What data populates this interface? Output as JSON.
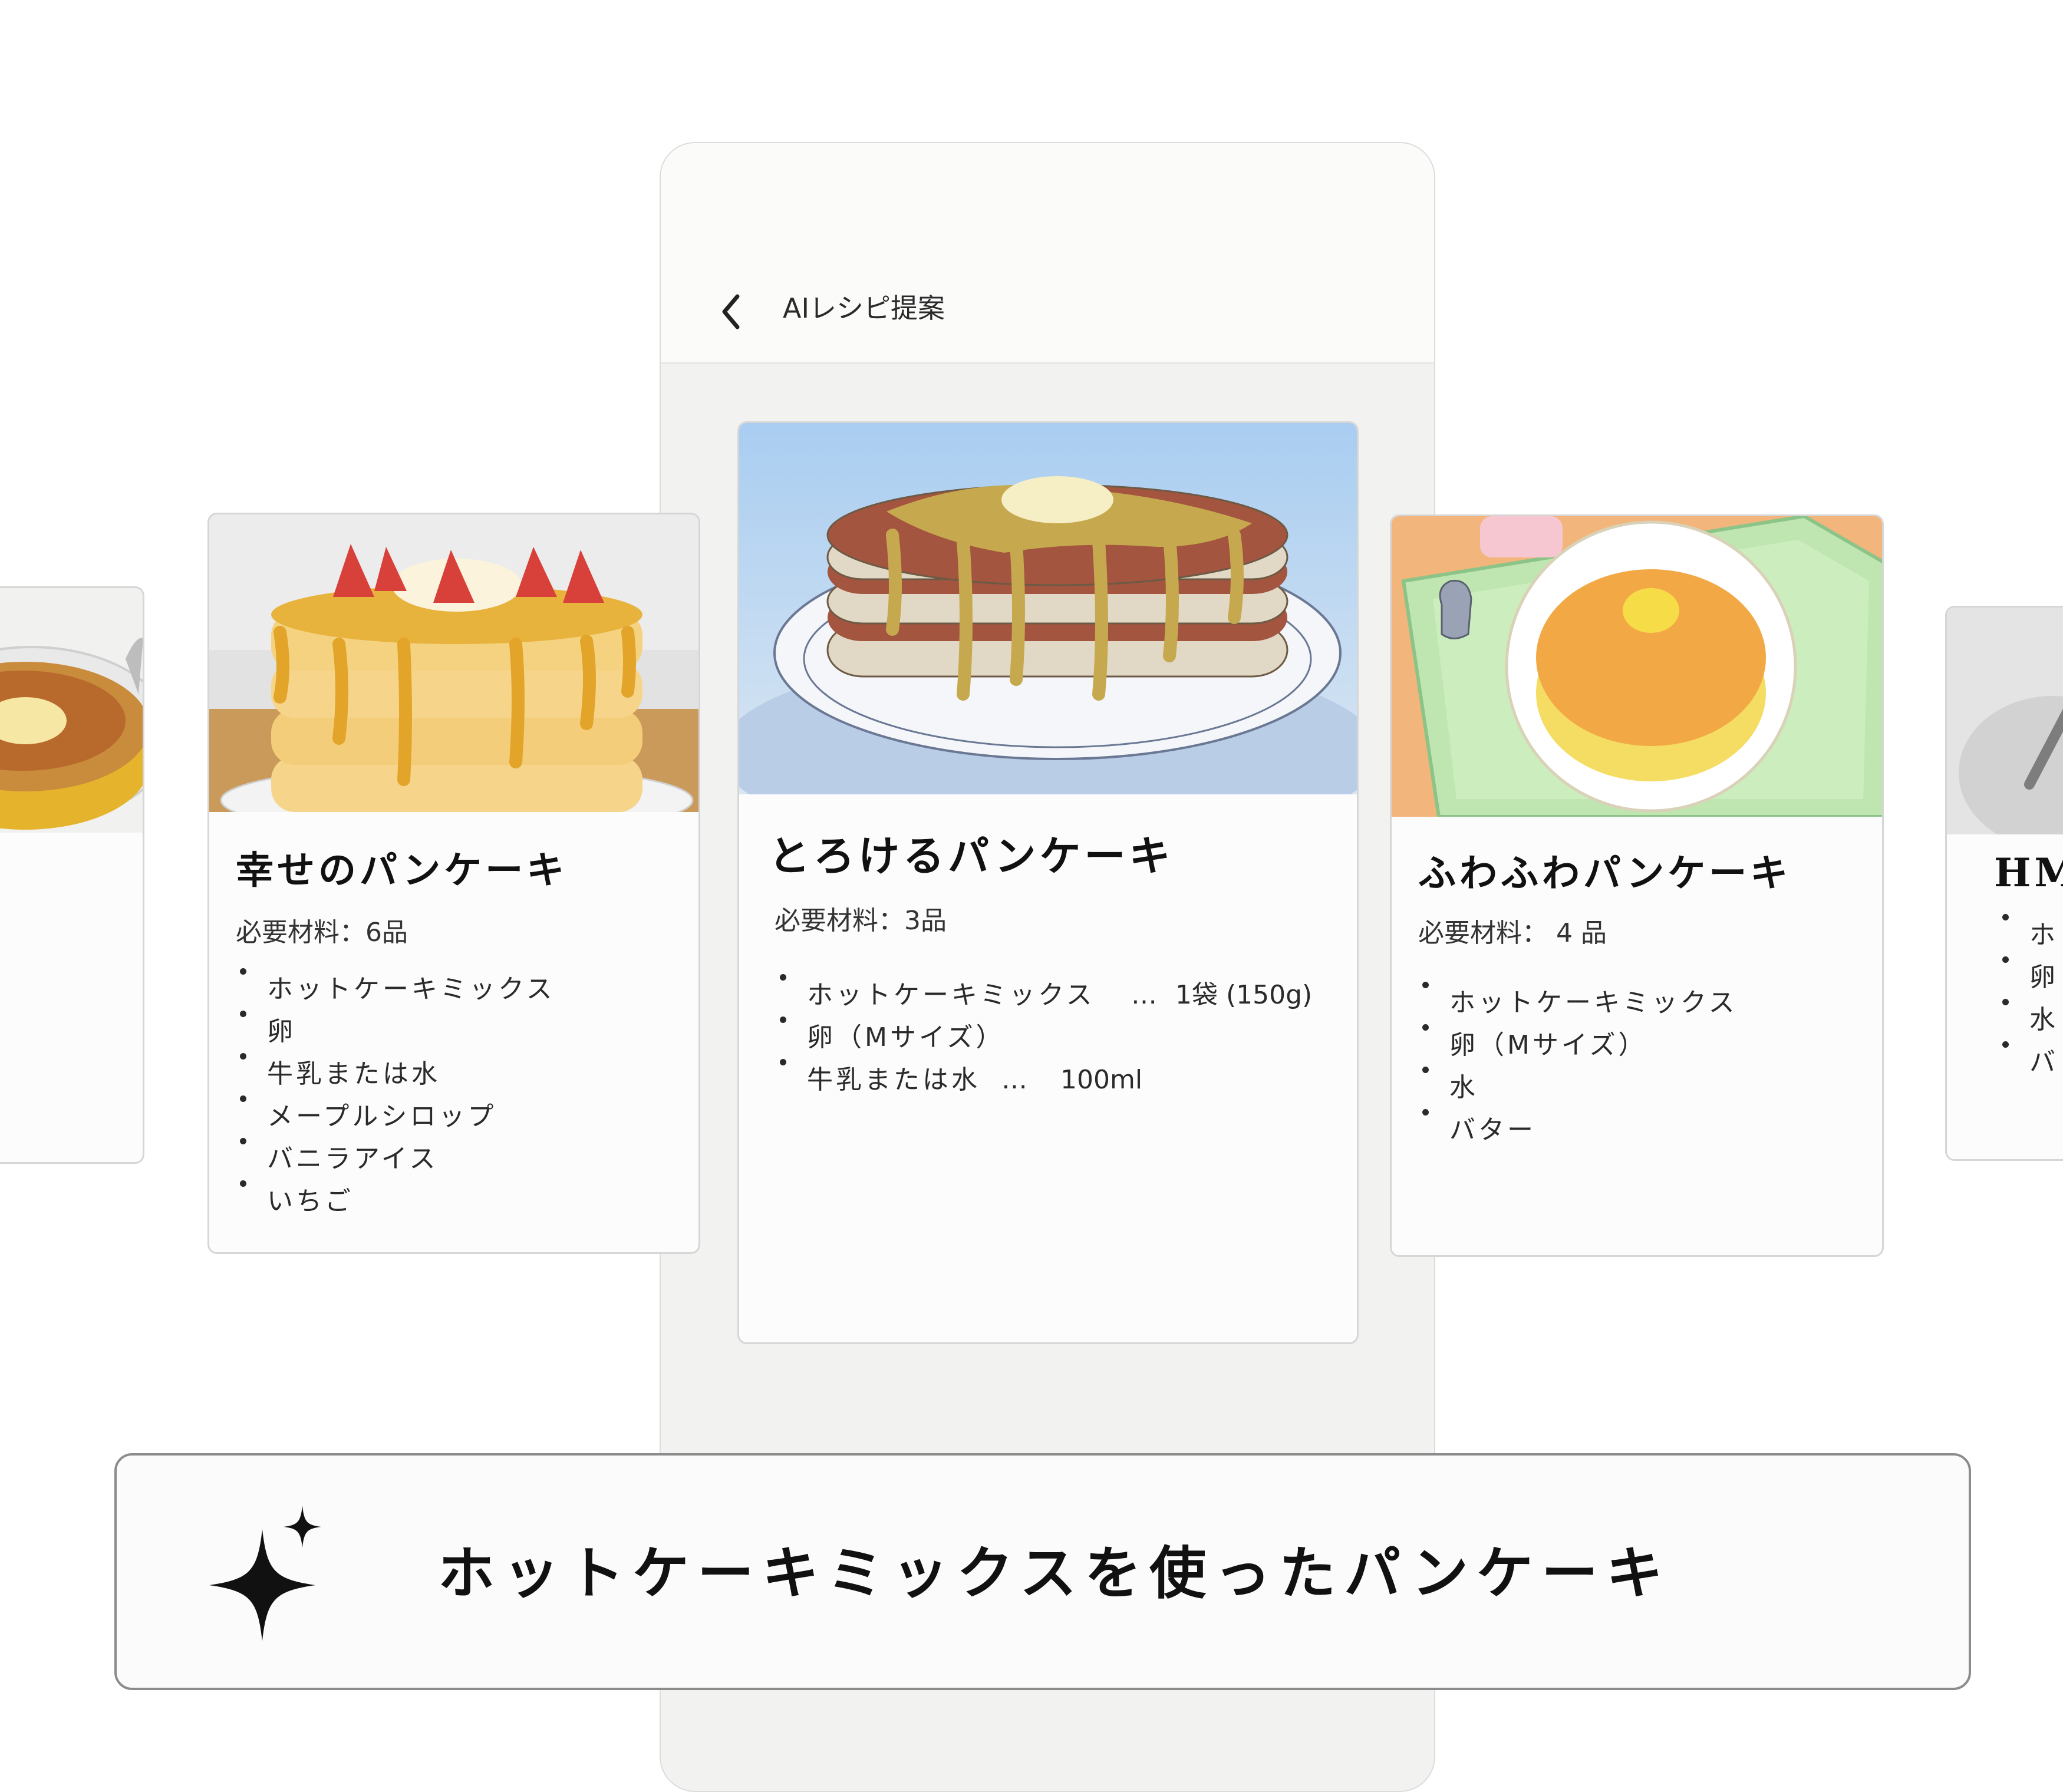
{
  "app": {
    "header_title": "AIレシピ提案",
    "back_icon": "chevron-left-icon"
  },
  "cards": {
    "left_partial": {
      "image": "pancake-with-butter-illustration"
    },
    "left": {
      "title": "幸せのパンケーキ",
      "required": "必要材料：6品",
      "image": "strawberry-pancake-stack-illustration",
      "ingredients": [
        "ホットケーキミックス",
        "卵",
        "牛乳または水",
        "メープルシロップ",
        "バニラアイス",
        "いちご"
      ]
    },
    "center": {
      "title": "とろけるパンケーキ",
      "required": "必要材料：3品",
      "image": "syrup-pancake-stack-illustration",
      "ingredients": [
        {
          "name": "ホットケーキミックス",
          "sep": "…",
          "qty": "1袋 (150g)"
        },
        {
          "name": "卵（Mサイズ）",
          "sep": "",
          "qty": ""
        },
        {
          "name": "牛乳または水",
          "sep": "…",
          "qty": "100ml"
        }
      ]
    },
    "right": {
      "title": "ふわふわパンケーキ",
      "required": "必要材料： 4 品",
      "image": "fluffy-pancake-on-tray-illustration",
      "ingredients": [
        "ホットケーキミックス",
        "卵（Mサイズ）",
        "水",
        "バター"
      ]
    },
    "right_partial": {
      "title": "HM",
      "image": "pancake-with-fork-illustration",
      "ingredients": [
        "ホ",
        "卵",
        "水",
        "バ"
      ]
    }
  },
  "prompt": {
    "text": "ホットケーキミックスを使ったパンケーキ",
    "icon": "sparkle-icon"
  },
  "colors": {
    "phone_bg": "#f2f3f1",
    "card_border": "#d6d6d6",
    "prompt_border": "#8c8c8c",
    "text": "#111111"
  }
}
